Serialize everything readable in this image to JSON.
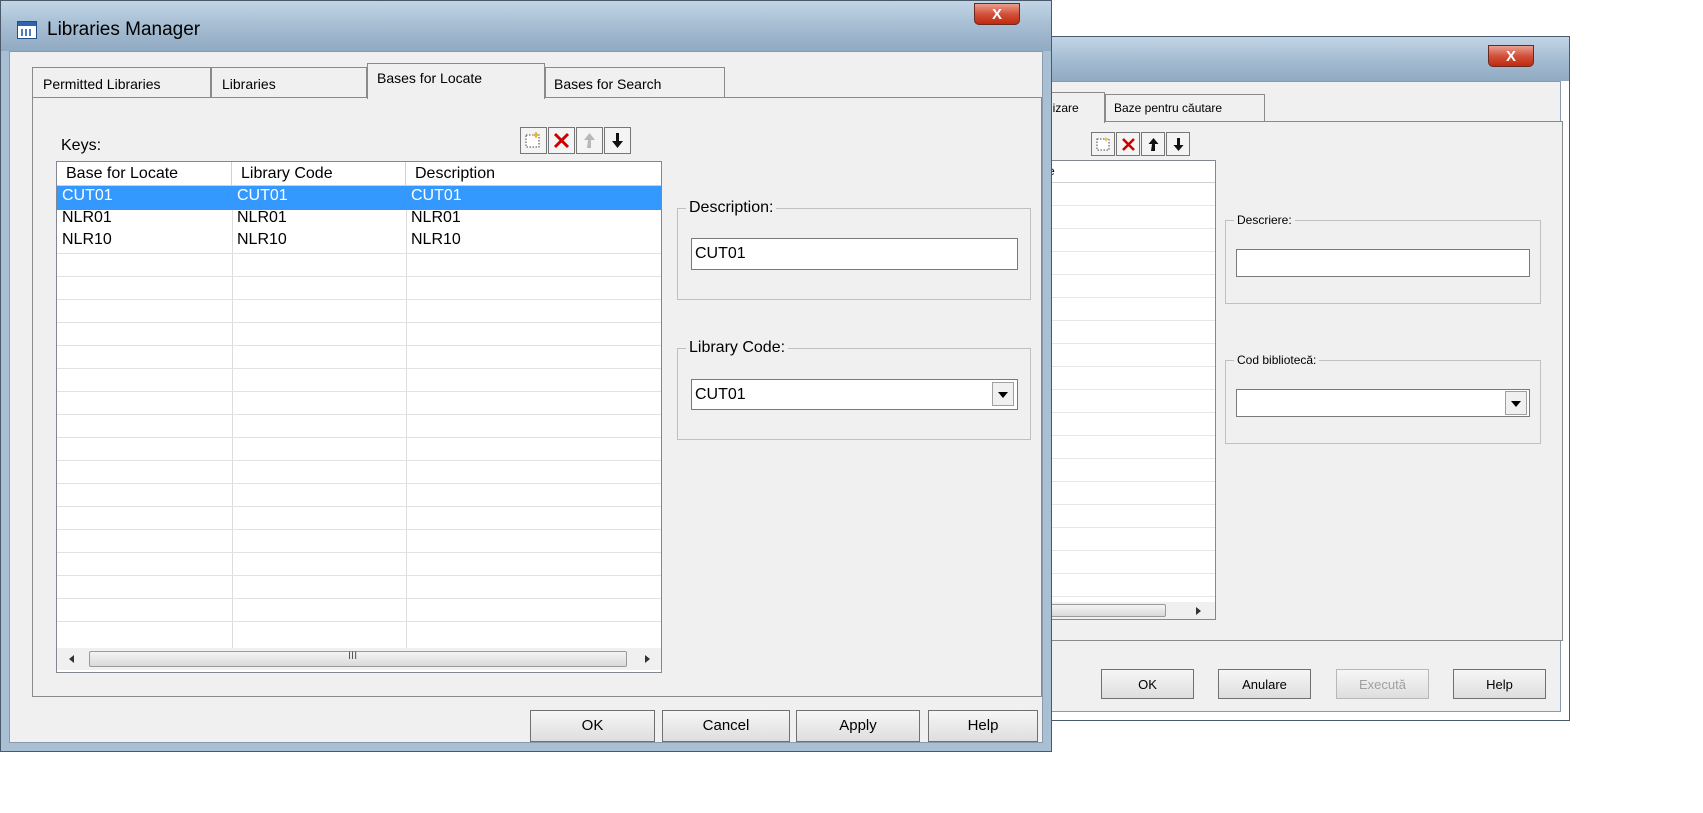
{
  "main_window": {
    "title": "Libraries Manager",
    "close_glyph": "X",
    "tabs": [
      {
        "label": "Permitted Libraries"
      },
      {
        "label": "Libraries"
      },
      {
        "label": "Bases for Locate"
      },
      {
        "label": "Bases for Search"
      }
    ],
    "active_tab": "Bases for Locate",
    "keys_label": "Keys:",
    "toolbar": [
      "new-icon",
      "delete-icon",
      "move-up-icon",
      "move-down-icon"
    ],
    "grid": {
      "columns": [
        "Base for Locate",
        "Library Code",
        "Description"
      ],
      "rows": [
        [
          "CUT01",
          "CUT01",
          "CUT01"
        ],
        [
          "NLR01",
          "NLR01",
          "NLR01"
        ],
        [
          "NLR10",
          "NLR10",
          "NLR10"
        ]
      ],
      "selected_row": 0,
      "scroll_grip": "III"
    },
    "description_group": {
      "label": "Description:",
      "value": "CUT01"
    },
    "library_code_group": {
      "label": "Library Code:",
      "value": "CUT01"
    },
    "buttons": {
      "ok": "OK",
      "cancel": "Cancel",
      "apply": "Apply",
      "help": "Help"
    }
  },
  "back_window": {
    "close_glyph": "X",
    "tabs": [
      {
        "label": "lizare"
      },
      {
        "label": "Baze pentru căutare"
      }
    ],
    "grid_header_partial": "e",
    "description_group": {
      "label": "Descriere:",
      "value": ""
    },
    "library_code_group": {
      "label": "Cod bibliotecă:",
      "value": ""
    },
    "buttons": {
      "ok": "OK",
      "cancel": "Anulare",
      "apply": "Execută",
      "help": "Help"
    }
  },
  "colors": {
    "selection": "#3399ff",
    "delete_icon": "#cc0000",
    "face": "#f0f0f0",
    "close_button": "#c8442c"
  }
}
